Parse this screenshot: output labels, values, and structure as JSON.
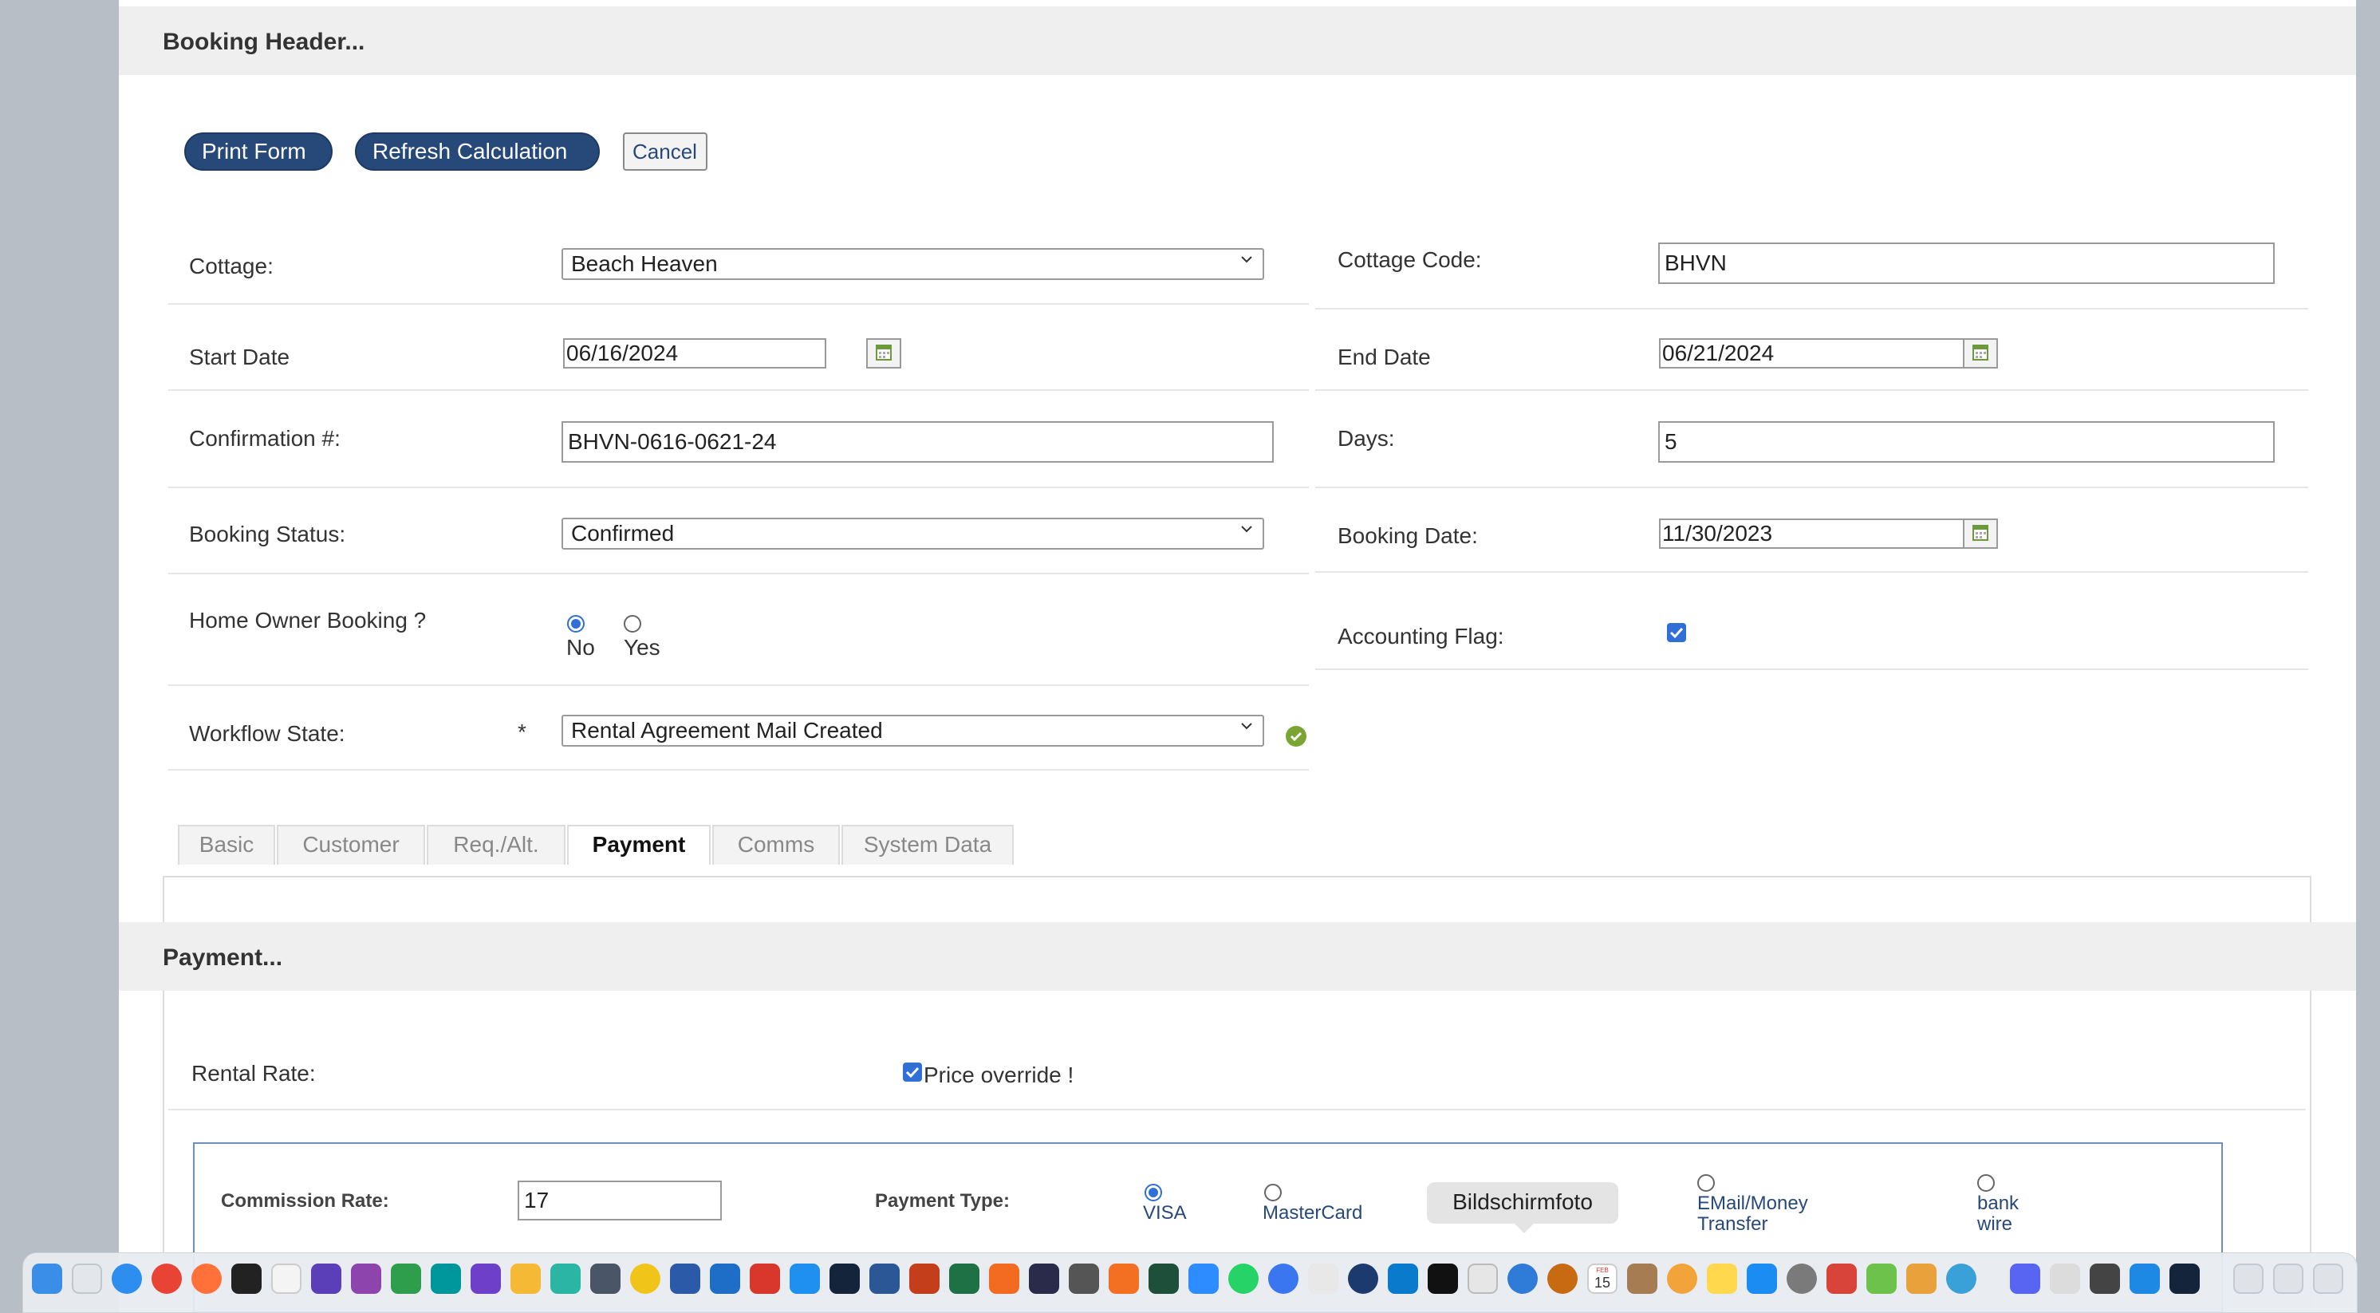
{
  "booking_header": {
    "title": "Booking Header...",
    "buttons": {
      "print": "Print Form",
      "refresh": "Refresh Calculation",
      "cancel": "Cancel"
    },
    "fields": {
      "cottage": {
        "label": "Cottage:",
        "value": "Beach Heaven"
      },
      "cottage_code": {
        "label": "Cottage Code:",
        "value": "BHVN"
      },
      "start_date": {
        "label": "Start Date",
        "value": "06/16/2024"
      },
      "end_date": {
        "label": "End Date",
        "value": "06/21/2024"
      },
      "confirmation": {
        "label": "Confirmation #:",
        "value": "BHVN-0616-0621-24"
      },
      "days": {
        "label": "Days:",
        "value": "5"
      },
      "booking_status": {
        "label": "Booking Status:",
        "value": "Confirmed"
      },
      "booking_date": {
        "label": "Booking Date:",
        "value": "11/30/2023"
      },
      "home_owner": {
        "label": "Home Owner Booking ?",
        "options": [
          "No",
          "Yes"
        ],
        "selected": "No"
      },
      "accounting_flag": {
        "label": "Accounting Flag:",
        "checked": true
      },
      "workflow_state": {
        "label": "Workflow State:",
        "required_mark": "*",
        "value": "Rental Agreement Mail Created"
      }
    }
  },
  "tabs": [
    "Basic",
    "Customer",
    "Req./Alt.",
    "Payment",
    "Comms",
    "System Data"
  ],
  "active_tab": "Payment",
  "payment": {
    "title": "Payment...",
    "rental_rate_label": "Rental Rate:",
    "price_override_label": "Price override !",
    "price_override_checked": true,
    "commission_rate_label": "Commission Rate:",
    "commission_rate_value": "17",
    "payment_type_label": "Payment Type:",
    "payment_types": [
      "VISA",
      "MasterCard",
      "EMail/Money Transfer",
      "bank wire"
    ],
    "payment_types_lines": [
      [
        "VISA"
      ],
      [
        "MasterCard"
      ],
      [
        "EMail/Money",
        "Transfer"
      ],
      [
        "bank",
        "wire"
      ]
    ],
    "selected_payment_type": "VISA"
  },
  "tooltip": "Bildschirmfoto",
  "dock": {
    "calendar_month": "FEB",
    "calendar_day": "15"
  }
}
